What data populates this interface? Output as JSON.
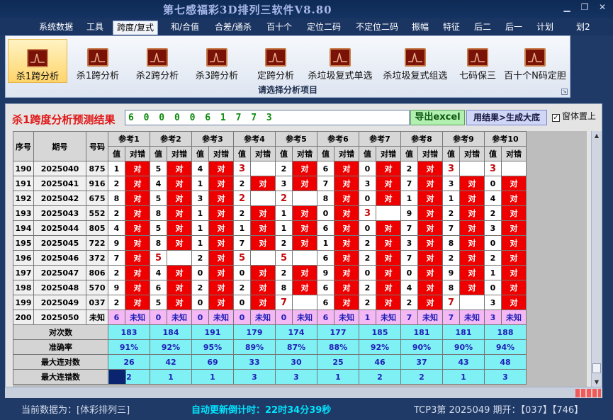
{
  "app": {
    "title": "第七感福彩3D排列三软件V8.80"
  },
  "menu": [
    "系统数据",
    "工具",
    "跨度/复式",
    "和/合值",
    "合差/通杀",
    "百十个",
    "定位二码",
    "不定位二码",
    "振幅",
    "特征",
    "后二",
    "后一",
    "计划",
    "划2"
  ],
  "menu_active": 2,
  "ribbon": {
    "items": [
      "杀1跨分析",
      "杀1跨分析",
      "杀2跨分析",
      "杀3跨分析",
      "定跨分析",
      "杀垃圾复式单选",
      "杀垃圾复式组选",
      "七码保三",
      "百十个N码定胆"
    ],
    "selected": 0,
    "group_label": "请选择分析项目",
    "icon": "chart-icon"
  },
  "result": {
    "label": "杀1跨度分析预测结果",
    "value": "6 0 0 0 0 6 1 7 7 3",
    "excel_btn": "导出excel",
    "gen_btn": "用结果>生成大底",
    "ontop_label": "窗体置上",
    "ontop_checked": true
  },
  "grid": {
    "headers": {
      "seq": "序号",
      "period": "期号",
      "code": "号码",
      "val": "值",
      "hit": "对错"
    },
    "refs": [
      "参考1",
      "参考2",
      "参考3",
      "参考4",
      "参考5",
      "参考6",
      "参考7",
      "参考8",
      "参考9",
      "参考10"
    ],
    "hit_text": "对",
    "rows": [
      {
        "seq": "190",
        "period": "2025040",
        "code": "875",
        "vals": [
          "1",
          "5",
          "4",
          "3",
          "2",
          "6",
          "0",
          "2",
          "3",
          "3"
        ],
        "hit": [
          1,
          1,
          1,
          0,
          1,
          1,
          1,
          1,
          0,
          0
        ]
      },
      {
        "seq": "191",
        "period": "2025041",
        "code": "916",
        "vals": [
          "2",
          "4",
          "1",
          "2",
          "3",
          "7",
          "3",
          "7",
          "3",
          "0"
        ],
        "hit": [
          1,
          1,
          1,
          1,
          1,
          1,
          1,
          1,
          1,
          1
        ]
      },
      {
        "seq": "192",
        "period": "2025042",
        "code": "675",
        "vals": [
          "8",
          "5",
          "3",
          "2",
          "2",
          "8",
          "0",
          "1",
          "1",
          "4"
        ],
        "hit": [
          1,
          1,
          1,
          0,
          0,
          1,
          1,
          1,
          1,
          1
        ]
      },
      {
        "seq": "193",
        "period": "2025043",
        "code": "552",
        "vals": [
          "2",
          "8",
          "1",
          "2",
          "1",
          "0",
          "3",
          "9",
          "2",
          "2"
        ],
        "hit": [
          1,
          1,
          1,
          1,
          1,
          1,
          0,
          1,
          1,
          1
        ]
      },
      {
        "seq": "194",
        "period": "2025044",
        "code": "805",
        "vals": [
          "4",
          "5",
          "1",
          "1",
          "1",
          "6",
          "0",
          "7",
          "7",
          "3"
        ],
        "hit": [
          1,
          1,
          1,
          1,
          1,
          1,
          1,
          1,
          1,
          1
        ]
      },
      {
        "seq": "195",
        "period": "2025045",
        "code": "722",
        "vals": [
          "9",
          "8",
          "1",
          "7",
          "2",
          "1",
          "2",
          "3",
          "8",
          "0"
        ],
        "hit": [
          1,
          1,
          1,
          1,
          1,
          1,
          1,
          1,
          1,
          1
        ]
      },
      {
        "seq": "196",
        "period": "2025046",
        "code": "372",
        "vals": [
          "7",
          "5",
          "2",
          "5",
          "5",
          "6",
          "2",
          "7",
          "2",
          "2"
        ],
        "hit": [
          1,
          0,
          1,
          0,
          0,
          1,
          1,
          1,
          1,
          1
        ]
      },
      {
        "seq": "197",
        "period": "2025047",
        "code": "806",
        "vals": [
          "2",
          "4",
          "0",
          "0",
          "2",
          "9",
          "0",
          "0",
          "9",
          "1"
        ],
        "hit": [
          1,
          1,
          1,
          1,
          1,
          1,
          1,
          1,
          1,
          1
        ]
      },
      {
        "seq": "198",
        "period": "2025048",
        "code": "570",
        "vals": [
          "9",
          "6",
          "2",
          "2",
          "8",
          "6",
          "2",
          "4",
          "8",
          "0"
        ],
        "hit": [
          1,
          1,
          1,
          1,
          1,
          1,
          1,
          1,
          1,
          1
        ]
      },
      {
        "seq": "199",
        "period": "2025049",
        "code": "037",
        "vals": [
          "2",
          "5",
          "0",
          "0",
          "7",
          "6",
          "2",
          "2",
          "7",
          "3"
        ],
        "hit": [
          1,
          1,
          1,
          1,
          0,
          1,
          1,
          1,
          0,
          1
        ]
      }
    ],
    "pending": {
      "seq": "200",
      "period": "2025050",
      "code": "未知",
      "vals": [
        "6",
        "0",
        "0",
        "0",
        "0",
        "6",
        "1",
        "7",
        "7",
        "3"
      ],
      "hit_text": "未知"
    },
    "stats": [
      {
        "label": "对次数",
        "vals": [
          "183",
          "184",
          "191",
          "179",
          "174",
          "177",
          "185",
          "181",
          "181",
          "188"
        ]
      },
      {
        "label": "准确率",
        "vals": [
          "91%",
          "92%",
          "95%",
          "89%",
          "87%",
          "88%",
          "92%",
          "90%",
          "90%",
          "94%"
        ]
      },
      {
        "label": "最大连对数",
        "vals": [
          "26",
          "42",
          "69",
          "33",
          "30",
          "25",
          "46",
          "37",
          "43",
          "48"
        ]
      },
      {
        "label": "最大连错数",
        "vals": [
          "2",
          "1",
          "1",
          "3",
          "3",
          "1",
          "2",
          "2",
          "1",
          "3"
        ]
      }
    ]
  },
  "status": {
    "current": "当前数据为：[体彩排列三]",
    "countdown_label": "自动更新倒计时：",
    "countdown": "22时34分39秒",
    "tcp": "TCP3第 2025049 期开：【037】【746】"
  }
}
